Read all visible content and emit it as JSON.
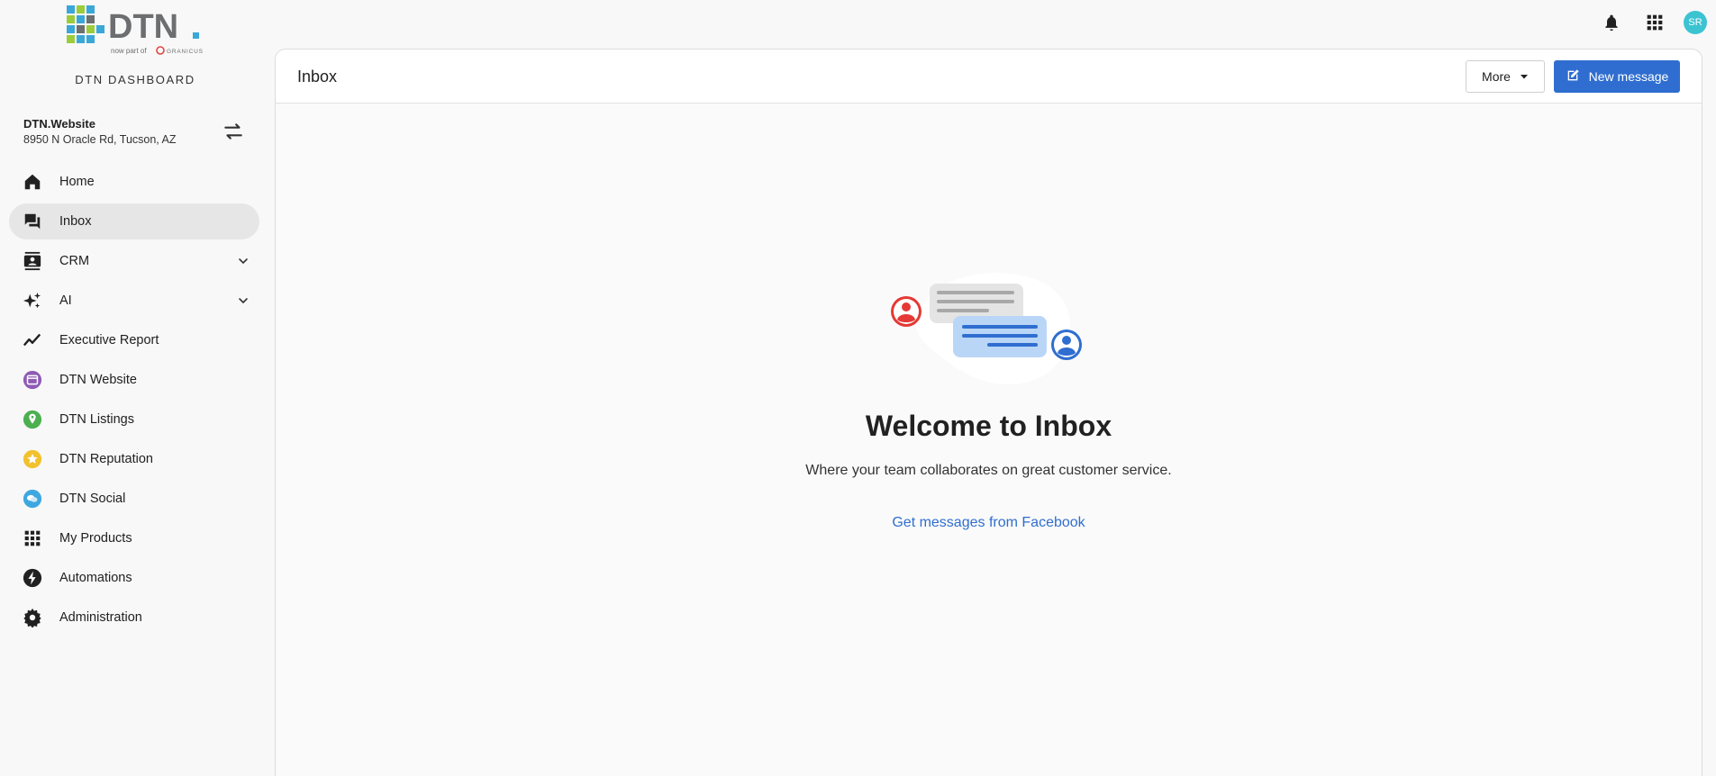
{
  "brand": {
    "logo_text": "DTN",
    "logo_sub": "now part of",
    "logo_partner": "GRANICUS",
    "dashboard_title": "DTN DASHBOARD",
    "colors": {
      "blue": "#3aa7d9",
      "green": "#9ccc3c",
      "gray": "#6d6e70"
    }
  },
  "account": {
    "name": "DTN.Website",
    "address": "8950 N Oracle Rd, Tucson, AZ",
    "switch_icon": "swap-arrows-icon"
  },
  "sidebar": {
    "items": [
      {
        "label": "Home",
        "icon": "home-icon"
      },
      {
        "label": "Inbox",
        "icon": "chat-icon",
        "active": true
      },
      {
        "label": "CRM",
        "icon": "contacts-icon",
        "expandable": true
      },
      {
        "label": "AI",
        "icon": "sparkle-icon",
        "expandable": true
      },
      {
        "label": "Executive Report",
        "icon": "trend-icon"
      },
      {
        "label": "DTN Website",
        "icon": "website-icon",
        "color": "#8e5bb5"
      },
      {
        "label": "DTN Listings",
        "icon": "location-pin-icon",
        "color": "#4caf50"
      },
      {
        "label": "DTN Reputation",
        "icon": "star-icon",
        "color": "#f2c12e"
      },
      {
        "label": "DTN Social",
        "icon": "social-bubble-icon",
        "color": "#3fa7e0"
      },
      {
        "label": "My Products",
        "icon": "grid-icon"
      },
      {
        "label": "Automations",
        "icon": "bolt-icon"
      },
      {
        "label": "Administration",
        "icon": "gear-icon"
      }
    ]
  },
  "topbar": {
    "avatar_initials": "SR",
    "avatar_color": "#3cc3d2"
  },
  "main": {
    "title": "Inbox",
    "more_label": "More",
    "new_message_label": "New message",
    "accent_color": "#2f6ed0",
    "empty_state": {
      "heading": "Welcome to Inbox",
      "subtext": "Where your team collaborates on great customer service.",
      "link": "Get messages from Facebook"
    }
  }
}
